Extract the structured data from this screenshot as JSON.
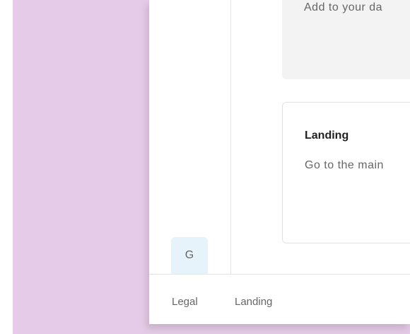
{
  "sidebar": {
    "avatar_letter": "G"
  },
  "cards": [
    {
      "description": "Add to your da"
    },
    {
      "title": "Landing",
      "description": "Go to the main"
    }
  ],
  "footer": {
    "links": [
      "Legal",
      "Landing"
    ]
  },
  "colors": {
    "background": "#e5cbe7",
    "avatar_bg": "#e7f3fb",
    "card_gray": "#f3f3f3"
  }
}
